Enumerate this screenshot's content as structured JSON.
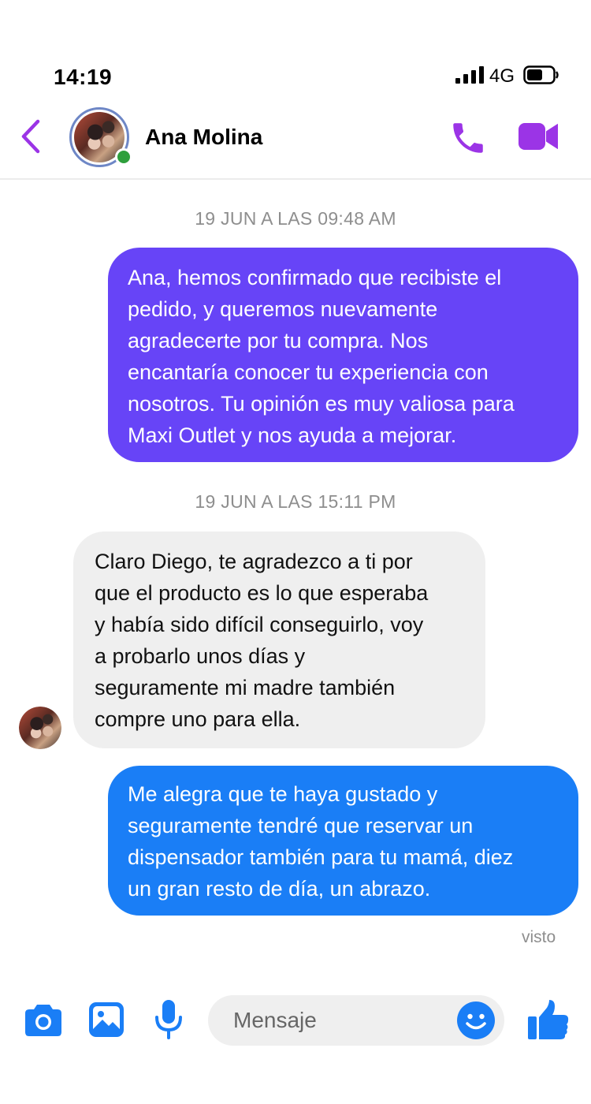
{
  "status_bar": {
    "time": "14:19",
    "network": "4G"
  },
  "header": {
    "contact_name": "Ana Molina"
  },
  "messages": [
    {
      "timestamp": "19 JUN A LAS 09:48 AM",
      "text": "Ana, hemos confirmado que recibiste el\npedido, y queremos nuevamente\nagradecerte por tu compra. Nos\nencantaría conocer tu experiencia con\nnosotros. Tu opinión es muy valiosa para\nMaxi Outlet y nos ayuda a mejorar."
    },
    {
      "timestamp": "19 JUN A LAS 15:11 PM",
      "text": "Claro Diego, te agradezco a ti por\nque el producto es lo que esperaba\ny había sido difícil conseguirlo, voy\na probarlo unos días y\nseguramente mi madre también\ncompre uno para ella."
    },
    {
      "text": "Me alegra que te haya gustado y\nseguramente tendré que reservar un\ndispensador también para tu mamá, diez\nun gran resto de día, un abrazo."
    }
  ],
  "seen_label": "visto",
  "composer": {
    "placeholder": "Mensaje"
  },
  "colors": {
    "accent": "#9b34e6",
    "outgoing_purple": "#6744f7",
    "outgoing_blue": "#1a7ef6",
    "incoming": "#efefef",
    "online": "#2e9f3c",
    "icon_blue": "#1a7ef6"
  },
  "icons": [
    "back-arrow-icon",
    "phone-icon",
    "video-camera-icon",
    "camera-icon",
    "gallery-icon",
    "microphone-icon",
    "emoji-icon",
    "thumbs-up-icon",
    "signal-icon",
    "battery-icon"
  ]
}
